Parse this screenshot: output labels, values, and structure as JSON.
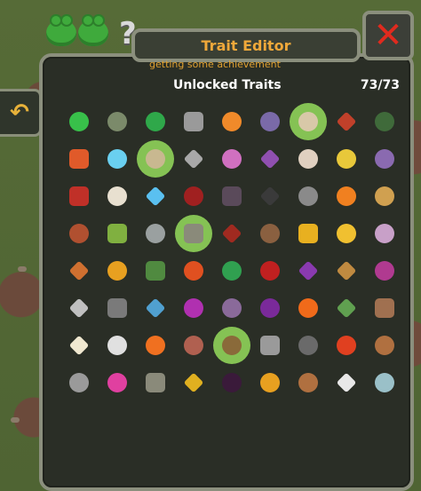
{
  "window": {
    "title": "Trait Editor",
    "close_label": "✕",
    "back_label": "↶"
  },
  "header": {
    "note": "getting some achievement",
    "section_label": "Unlocked Traits",
    "count": "73/73"
  },
  "decor": {
    "question_mark": "?"
  },
  "traits": [
    {
      "icon": "green-heart-icon",
      "color": "#38c04a",
      "shape": "round",
      "selected": false
    },
    {
      "icon": "mossy-rock-icon",
      "color": "#7b8a6a",
      "shape": "round",
      "selected": false
    },
    {
      "icon": "green-claw-icon",
      "color": "#2fa84a",
      "shape": "round",
      "selected": false
    },
    {
      "icon": "gray-block-icon",
      "color": "#9a9a9a",
      "shape": "square",
      "selected": false
    },
    {
      "icon": "orange-face-icon",
      "color": "#f08a2a",
      "shape": "round",
      "selected": false
    },
    {
      "icon": "purple-orb-icon",
      "color": "#7a6aa8",
      "shape": "round",
      "selected": false
    },
    {
      "icon": "hooded-figure-icon",
      "color": "#d8c8a8",
      "shape": "round",
      "selected": true
    },
    {
      "icon": "red-dagger-icon",
      "color": "#c0402a",
      "shape": "diamond",
      "selected": false
    },
    {
      "icon": "dark-green-bug-icon",
      "color": "#3f6a3a",
      "shape": "round",
      "selected": false
    },
    {
      "icon": "fire-claws-icon",
      "color": "#e05a2a",
      "shape": "square",
      "selected": false
    },
    {
      "icon": "blue-ghost-icon",
      "color": "#6ad0f0",
      "shape": "round",
      "selected": false
    },
    {
      "icon": "skull-badge-icon",
      "color": "#c8b890",
      "shape": "round",
      "selected": true
    },
    {
      "icon": "gray-arrows-icon",
      "color": "#a8a8a8",
      "shape": "diamond",
      "selected": false
    },
    {
      "icon": "pink-creature-icon",
      "color": "#d070c0",
      "shape": "round",
      "selected": false
    },
    {
      "icon": "purple-crow-icon",
      "color": "#9050b0",
      "shape": "diamond",
      "selected": false
    },
    {
      "icon": "bone-skull-icon",
      "color": "#e0d0c0",
      "shape": "round",
      "selected": false
    },
    {
      "icon": "yellow-flower-icon",
      "color": "#e8c83a",
      "shape": "round",
      "selected": false
    },
    {
      "icon": "purple-spider-icon",
      "color": "#8a6ab0",
      "shape": "round",
      "selected": false
    },
    {
      "icon": "red-dragon-icon",
      "color": "#c03028",
      "shape": "square",
      "selected": false
    },
    {
      "icon": "eagle-icon",
      "color": "#e8e0d0",
      "shape": "round",
      "selected": false
    },
    {
      "icon": "lightning-icon",
      "color": "#5ac0f0",
      "shape": "diamond",
      "selected": false
    },
    {
      "icon": "dark-red-brain-icon",
      "color": "#a02020",
      "shape": "round",
      "selected": false
    },
    {
      "icon": "dark-tower-icon",
      "color": "#5a4a5a",
      "shape": "square",
      "selected": false
    },
    {
      "icon": "bat-icon",
      "color": "#3a3a3a",
      "shape": "diamond",
      "selected": false
    },
    {
      "icon": "gray-golem-icon",
      "color": "#8a8a8a",
      "shape": "round",
      "selected": false
    },
    {
      "icon": "orange-heart-icon",
      "color": "#f08020",
      "shape": "round",
      "selected": false
    },
    {
      "icon": "stone-explosion-icon",
      "color": "#d0a050",
      "shape": "round",
      "selected": false
    },
    {
      "icon": "meat-leg-icon",
      "color": "#b05030",
      "shape": "round",
      "selected": false
    },
    {
      "icon": "green-bottle-icon",
      "color": "#80b040",
      "shape": "square",
      "selected": false
    },
    {
      "icon": "stone-splash-icon",
      "color": "#9aa0a0",
      "shape": "round",
      "selected": false
    },
    {
      "icon": "tombstone-icon",
      "color": "#8a8a7a",
      "shape": "square",
      "selected": true
    },
    {
      "icon": "fire-demon-icon",
      "color": "#a02a20",
      "shape": "diamond",
      "selected": false
    },
    {
      "icon": "brown-beast-icon",
      "color": "#8a6040",
      "shape": "round",
      "selected": false
    },
    {
      "icon": "golden-tooth-icon",
      "color": "#e8b020",
      "shape": "square",
      "selected": false
    },
    {
      "icon": "gold-coins-icon",
      "color": "#f0c030",
      "shape": "round",
      "selected": false
    },
    {
      "icon": "purple-brain-icon",
      "color": "#c8a0c8",
      "shape": "round",
      "selected": false
    },
    {
      "icon": "scales-icon",
      "color": "#d07030",
      "shape": "diamond",
      "selected": false
    },
    {
      "icon": "infinity-icon",
      "color": "#e8a020",
      "shape": "round",
      "selected": false
    },
    {
      "icon": "green-shield-icon",
      "color": "#508a40",
      "shape": "square",
      "selected": false
    },
    {
      "icon": "red-flame-shield-icon",
      "color": "#e05020",
      "shape": "round",
      "selected": false
    },
    {
      "icon": "clover-icon",
      "color": "#30a050",
      "shape": "round",
      "selected": false
    },
    {
      "icon": "red-eye-icon",
      "color": "#c02020",
      "shape": "round",
      "selected": false
    },
    {
      "icon": "witch-icon",
      "color": "#8a3ab0",
      "shape": "diamond",
      "selected": false
    },
    {
      "icon": "pickaxe-icon",
      "color": "#c08a40",
      "shape": "diamond",
      "selected": false
    },
    {
      "icon": "purple-bush-icon",
      "color": "#b03a90",
      "shape": "round",
      "selected": false
    },
    {
      "icon": "hand-crystal-icon",
      "color": "#c0c0c0",
      "shape": "diamond",
      "selected": false
    },
    {
      "icon": "gravestone-icon",
      "color": "#7a7a7a",
      "shape": "square",
      "selected": false
    },
    {
      "icon": "pinwheel-icon",
      "color": "#50a0d0",
      "shape": "diamond",
      "selected": false
    },
    {
      "icon": "purple-virus-icon",
      "color": "#b030b0",
      "shape": "round",
      "selected": false
    },
    {
      "icon": "rocky-purple-icon",
      "color": "#8a6a9a",
      "shape": "round",
      "selected": false
    },
    {
      "icon": "purple-blob-icon",
      "color": "#7a2a9a",
      "shape": "round",
      "selected": false
    },
    {
      "icon": "campfire-icon",
      "color": "#f06a1a",
      "shape": "round",
      "selected": false
    },
    {
      "icon": "leaf-icon",
      "color": "#60a050",
      "shape": "diamond",
      "selected": false
    },
    {
      "icon": "brown-cat-icon",
      "color": "#a07050",
      "shape": "square",
      "selected": false
    },
    {
      "icon": "sparkle-icon",
      "color": "#f0e8d0",
      "shape": "diamond",
      "selected": false
    },
    {
      "icon": "glasses-icon",
      "color": "#e0e0e0",
      "shape": "round",
      "selected": false
    },
    {
      "icon": "small-flame-icon",
      "color": "#f07020",
      "shape": "round",
      "selected": false
    },
    {
      "icon": "red-snail-icon",
      "color": "#b06050",
      "shape": "round",
      "selected": false
    },
    {
      "icon": "snail-shell-icon",
      "color": "#8a6a3a",
      "shape": "round",
      "selected": true
    },
    {
      "icon": "gray-grave-icon",
      "color": "#9a9a9a",
      "shape": "square",
      "selected": false
    },
    {
      "icon": "dark-sack-icon",
      "color": "#6a6a6a",
      "shape": "round",
      "selected": false
    },
    {
      "icon": "flame-heart-icon",
      "color": "#e04020",
      "shape": "round",
      "selected": false
    },
    {
      "icon": "brown-bread-icon",
      "color": "#b07040",
      "shape": "round",
      "selected": false
    },
    {
      "icon": "gray-rock-icon",
      "color": "#9a9a9a",
      "shape": "round",
      "selected": false
    },
    {
      "icon": "pink-gem-icon",
      "color": "#e040a0",
      "shape": "round",
      "selected": false
    },
    {
      "icon": "stone-tomb-icon",
      "color": "#8a8a7a",
      "shape": "square",
      "selected": false
    },
    {
      "icon": "yellow-bird-icon",
      "color": "#e0b020",
      "shape": "diamond",
      "selected": false
    },
    {
      "icon": "dark-mouth-icon",
      "color": "#3a1a3a",
      "shape": "round",
      "selected": false
    },
    {
      "icon": "gold-medal-icon",
      "color": "#e8a020",
      "shape": "round",
      "selected": false
    },
    {
      "icon": "muscle-arm-icon",
      "color": "#b07040",
      "shape": "round",
      "selected": false
    },
    {
      "icon": "white-feather-icon",
      "color": "#e8e8e8",
      "shape": "diamond",
      "selected": false
    },
    {
      "icon": "diving-helmet-icon",
      "color": "#9ac0c8",
      "shape": "round",
      "selected": false
    },
    {
      "icon": "empty",
      "color": "transparent",
      "shape": "round",
      "selected": false
    }
  ]
}
